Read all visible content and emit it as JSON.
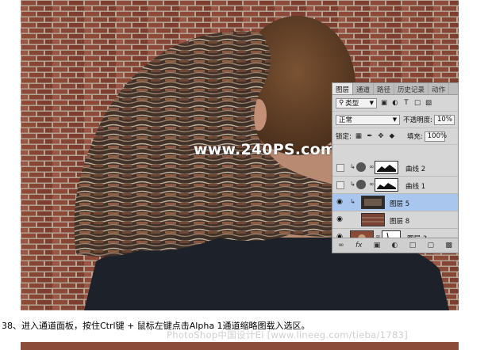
{
  "watermark": "www.240PS.com",
  "panel": {
    "tabs": [
      "图层",
      "通道",
      "路径",
      "历史记录",
      "动作"
    ],
    "active_tab": "图层",
    "filter_label": "类型",
    "blend_mode": "正常",
    "opacity_label": "不透明度:",
    "opacity_value": "10%",
    "lock_label": "锁定:",
    "fill_label": "填充:",
    "fill_value": "100%",
    "layers": [
      {
        "name": "曲线 2",
        "visible": false,
        "type": "curves"
      },
      {
        "name": "曲线 1",
        "visible": false,
        "type": "curves"
      },
      {
        "name": "图层 5",
        "visible": true,
        "type": "pixel",
        "selected": true
      },
      {
        "name": "图层 8",
        "visible": true,
        "type": "pixel"
      },
      {
        "name": "图层 3",
        "visible": true,
        "type": "pixel-mask"
      }
    ]
  },
  "caption": "38、进入通道面板，按住Ctrl键 + 鼠标左键点击Alpha 1通道缩略图载入选区。",
  "footer_watermark": "PhotoShop中国设计Ei [www.lineeg.com/tieba/1783]",
  "colors": {
    "brick": "#8a4a38",
    "mortar": "#b9a99a",
    "selected_layer": "#a9c7ee",
    "panel_bg": "#d6d6d6"
  }
}
